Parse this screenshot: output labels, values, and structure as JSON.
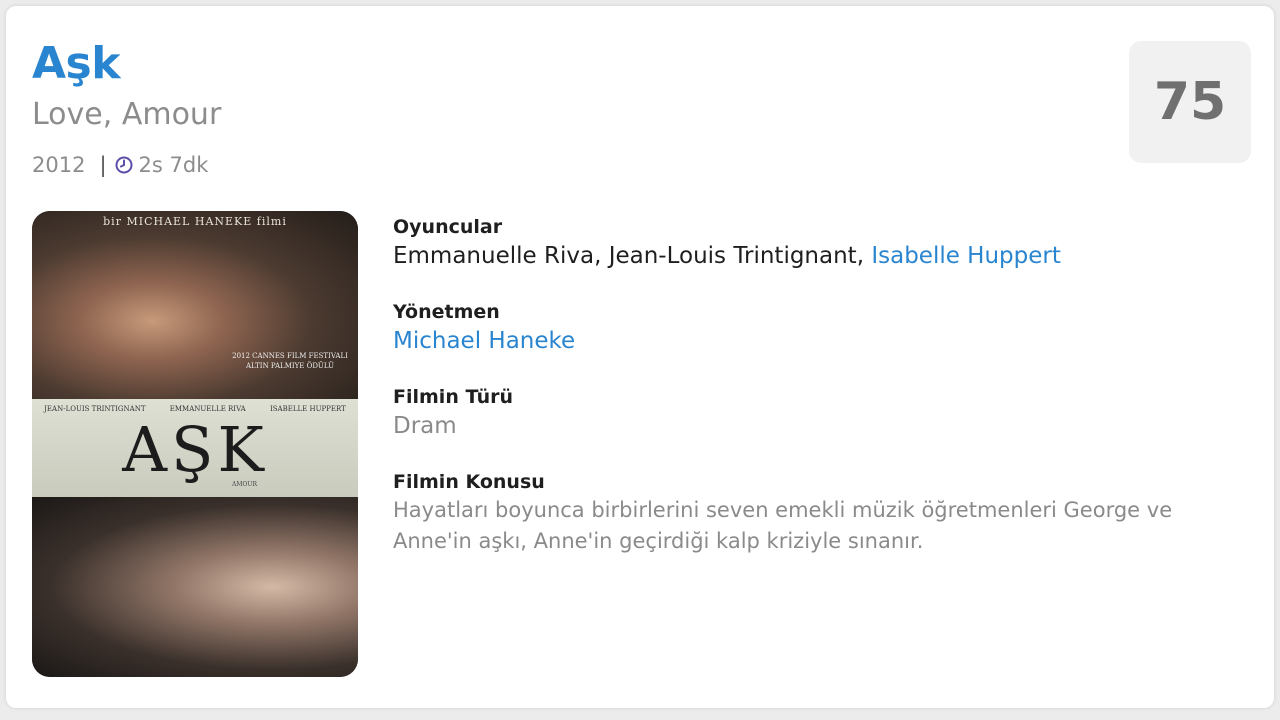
{
  "movie": {
    "title": "Aşk",
    "alt_title": "Love, Amour",
    "year": "2012",
    "separator": "|",
    "duration": "2s 7dk",
    "score": "75"
  },
  "poster": {
    "director_line": "bir MICHAEL HANEKE filmi",
    "festival": "2012 CANNES FILM FESTIVALI ALTIN PALMIYE ÖDÜLÜ",
    "cast": [
      "JEAN-LOUIS TRINTIGNANT",
      "EMMANUELLE RIVA",
      "ISABELLE HUPPERT"
    ],
    "title": "AŞK",
    "subtitle": "AMOUR"
  },
  "details": {
    "cast_label": "Oyuncular",
    "cast": [
      {
        "name": "Emmanuelle Riva",
        "sep": ", "
      },
      {
        "name": "Jean-Louis Trintignant",
        "sep": ", "
      },
      {
        "name": "Isabelle Huppert",
        "sep": ""
      }
    ],
    "director_label": "Yönetmen",
    "director": "Michael Haneke",
    "genre_label": "Filmin Türü",
    "genre": "Dram",
    "plot_label": "Filmin Konusu",
    "plot": "Hayatları boyunca birbirlerini seven emekli müzik öğretmenleri George ve Anne'in aşkı, Anne'in geçirdiği kalp kriziyle sınanır."
  },
  "colors": {
    "accent": "#2a85d0",
    "muted": "#8a8a8a",
    "score_bg": "#f1f1f1",
    "clock_icon": "#5b4fa8"
  },
  "icons": {
    "duration": "clock-icon"
  }
}
